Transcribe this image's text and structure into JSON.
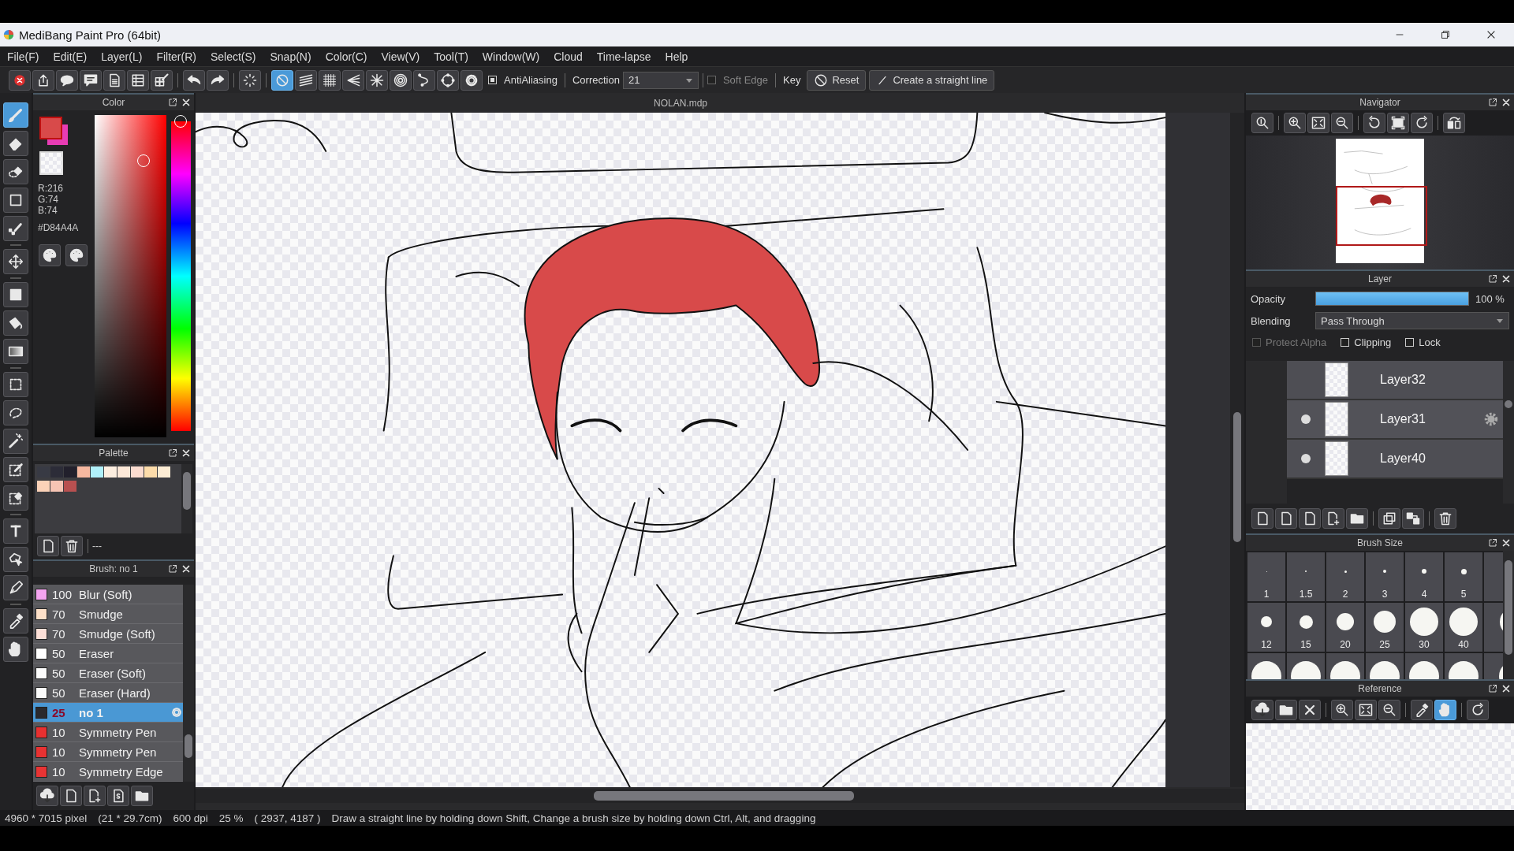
{
  "window": {
    "title": "MediBang Paint Pro (64bit)"
  },
  "menu": [
    "File(F)",
    "Edit(E)",
    "Layer(L)",
    "Filter(R)",
    "Select(S)",
    "Snap(N)",
    "Color(C)",
    "View(V)",
    "Tool(T)",
    "Window(W)",
    "Cloud",
    "Time-lapse",
    "Help"
  ],
  "toolbar": {
    "snaps": [
      {
        "kind": "none",
        "selected": true
      },
      {
        "kind": "parallel",
        "selected": false
      },
      {
        "kind": "grid",
        "selected": false
      },
      {
        "kind": "perspective",
        "selected": false
      },
      {
        "kind": "radial",
        "selected": false
      },
      {
        "kind": "concentric",
        "selected": false
      },
      {
        "kind": "curve",
        "selected": false
      },
      {
        "kind": "ellipse",
        "selected": false
      }
    ],
    "antialiasing": {
      "label": "AntiAliasing",
      "checked": true
    },
    "correction": {
      "label": "Correction",
      "value": "21"
    },
    "soft_edge": {
      "label": "Soft Edge",
      "checked": false,
      "disabled": true
    },
    "key_label": "Key",
    "reset": "Reset",
    "straight_line": "Create a straight line"
  },
  "tool_groups": [
    [
      {
        "kind": "brush",
        "selected": true
      },
      {
        "kind": "eraser",
        "selected": false
      },
      {
        "kind": "sel_eraser",
        "selected": false
      },
      {
        "kind": "rect",
        "selected": false
      },
      {
        "kind": "dot",
        "selected": false
      }
    ],
    [
      {
        "kind": "move",
        "selected": false
      }
    ],
    [
      {
        "kind": "fill",
        "selected": false
      },
      {
        "kind": "bucket",
        "selected": false
      },
      {
        "kind": "gradient",
        "selected": false
      }
    ],
    [
      {
        "kind": "sel_rect",
        "selected": false
      },
      {
        "kind": "lasso",
        "selected": false
      },
      {
        "kind": "wand",
        "selected": false
      },
      {
        "kind": "sel_pen",
        "selected": false
      },
      {
        "kind": "sel_erase",
        "selected": false
      }
    ],
    [
      {
        "kind": "text",
        "selected": false
      },
      {
        "kind": "operation",
        "selected": false
      },
      {
        "kind": "divide",
        "selected": false
      }
    ],
    [
      {
        "kind": "dropper",
        "selected": false
      },
      {
        "kind": "hand",
        "selected": false
      }
    ]
  ],
  "color_panel": {
    "title": "Color",
    "swatches": [
      {
        "kind": "foreground",
        "color": "#d84a4a"
      },
      {
        "kind": "background",
        "color": "#e83cb4"
      }
    ],
    "hue": {
      "level": 0
    },
    "rgb": [
      "R:216",
      "G:74",
      "B:74"
    ],
    "hex": "#D84A4A"
  },
  "palette": {
    "title": "Palette",
    "swatches": [
      {
        "color": "#383a44"
      },
      {
        "color": "#2c2c38"
      },
      {
        "color": "#22202c"
      },
      {
        "color": "#f6b8a0"
      },
      {
        "color": "#b0f0fa"
      },
      {
        "color": "#fdeee0"
      },
      {
        "color": "#fde8d8"
      },
      {
        "color": "#fbdcd0"
      },
      {
        "color": "#fddcaa"
      },
      {
        "color": "#fdecd4"
      },
      {
        "color": "#fbd2b8"
      },
      {
        "color": "#f6c4b4"
      },
      {
        "color": "#b85050"
      }
    ],
    "footer": "---"
  },
  "brush_panel": {
    "title": "Brush: no 1",
    "brushes": [
      {
        "size": "100",
        "name": "Blur (Soft)",
        "color": "#f4a4f0",
        "selected": false
      },
      {
        "size": "70",
        "name": "Smudge",
        "color": "#fde0c8",
        "selected": false
      },
      {
        "size": "70",
        "name": "Smudge (Soft)",
        "color": "#fde0d8",
        "selected": false
      },
      {
        "size": "50",
        "name": "Eraser",
        "color": "#ffffff",
        "selected": false
      },
      {
        "size": "50",
        "name": "Eraser (Soft)",
        "color": "#fcfcfc",
        "selected": false
      },
      {
        "size": "50",
        "name": "Eraser (Hard)",
        "color": "#fafafa",
        "selected": false
      },
      {
        "size": "25",
        "name": "no 1",
        "color": "#2a2a2e",
        "selected": true
      },
      {
        "size": "10",
        "name": "Symmetry Pen",
        "color": "#e83030",
        "selected": false
      },
      {
        "size": "10",
        "name": "Symmetry Pen",
        "color": "#e83232",
        "selected": false
      },
      {
        "size": "10",
        "name": "Symmetry Edge",
        "color": "#e83434",
        "selected": false
      }
    ]
  },
  "canvas": {
    "title": "NOLAN.mdp"
  },
  "navigator": {
    "title": "Navigator"
  },
  "layer_panel": {
    "title": "Layer",
    "opacity_label": "Opacity",
    "opacity": {
      "level": 1
    },
    "opacity_value": "100 %",
    "blending_label": "Blending",
    "blending": "Pass Through",
    "options": [
      {
        "label": "Protect Alpha",
        "checked": false,
        "disabled": true
      },
      {
        "label": "Clipping",
        "checked": false,
        "disabled": false
      },
      {
        "label": "Lock",
        "checked": false,
        "disabled": false
      }
    ],
    "layers": [
      {
        "name": "Layer32",
        "visible": false,
        "selected": false
      },
      {
        "name": "Layer31",
        "visible": true,
        "selected": true
      },
      {
        "name": "Layer40",
        "visible": true,
        "selected": false
      }
    ]
  },
  "brush_size": {
    "title": "Brush Size",
    "rows": [
      [
        "1",
        "1.5",
        "2",
        "3",
        "4",
        "5"
      ],
      [
        "12",
        "15",
        "20",
        "25",
        "30",
        "40"
      ]
    ]
  },
  "reference": {
    "title": "Reference",
    "tools": [
      {
        "kind": "dropper",
        "selected": false
      },
      {
        "kind": "hand",
        "selected": true
      }
    ]
  },
  "status_bar": [
    "4960 * 7015 pixel",
    "(21 * 29.7cm)",
    "600 dpi",
    "25 %",
    "( 2937, 4187 )",
    "Draw a straight line by holding down Shift, Change a brush size by holding down Ctrl, Alt, and dragging"
  ]
}
